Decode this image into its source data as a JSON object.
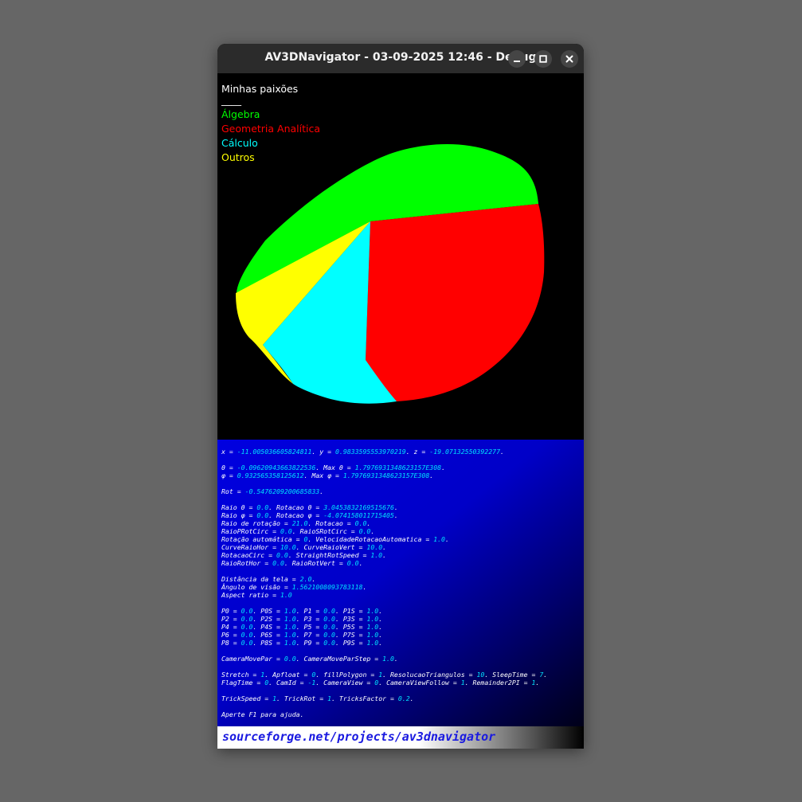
{
  "window": {
    "title": "AV3DNavigator - 03-09-2025 12:46 - Debug",
    "buttons": {
      "minimize_icon": "minimize-icon",
      "maximize_icon": "maximize-icon",
      "close_icon": "close-icon"
    }
  },
  "legend": {
    "title": "Minhas paixões",
    "separator": "____",
    "items": [
      {
        "label": "Álgebra",
        "color": "#00ff00"
      },
      {
        "label": "Geometria Analítica",
        "color": "#ff0000"
      },
      {
        "label": "Cálculo",
        "color": "#00ffff"
      },
      {
        "label": "Outros",
        "color": "#ffff00"
      }
    ]
  },
  "info_lines": [
    [
      [
        "x = ",
        0
      ],
      [
        "-11.005036605824811",
        1
      ],
      [
        ". y = ",
        0
      ],
      [
        "0.9833595553970219",
        1
      ],
      [
        ". z = ",
        0
      ],
      [
        "-19.07132550392277",
        1
      ],
      [
        ".",
        0
      ]
    ],
    [],
    [
      [
        "θ = ",
        0
      ],
      [
        "-0.09620943663822536",
        1
      ],
      [
        ". Max θ = ",
        0
      ],
      [
        "1.7976931348623157E308",
        1
      ],
      [
        ".",
        0
      ]
    ],
    [
      [
        "φ = ",
        0
      ],
      [
        "0.932565358125612",
        1
      ],
      [
        ". Max φ = ",
        0
      ],
      [
        "1.7976931348623157E308",
        1
      ],
      [
        ".",
        0
      ]
    ],
    [],
    [
      [
        "Rot = ",
        0
      ],
      [
        "-0.5476209200685833",
        1
      ],
      [
        ".",
        0
      ]
    ],
    [],
    [
      [
        "Raio θ = ",
        0
      ],
      [
        "0.0",
        1
      ],
      [
        ". Rotacao θ = ",
        0
      ],
      [
        "3.0453832169515676",
        1
      ],
      [
        ".",
        0
      ]
    ],
    [
      [
        "Raio φ = ",
        0
      ],
      [
        "0.0",
        1
      ],
      [
        ". Rotacao φ = ",
        0
      ],
      [
        "-4.074158011715405",
        1
      ],
      [
        ".",
        0
      ]
    ],
    [
      [
        "Raio de rotação = ",
        0
      ],
      [
        "21.0",
        1
      ],
      [
        ". Rotacao = ",
        0
      ],
      [
        "0.0",
        1
      ],
      [
        ".",
        0
      ]
    ],
    [
      [
        "RaioPRotCirc = ",
        0
      ],
      [
        "0.0",
        1
      ],
      [
        ". RaioSRotCirc = ",
        0
      ],
      [
        "0.0",
        1
      ],
      [
        ".",
        0
      ]
    ],
    [
      [
        "Rotação automática = ",
        0
      ],
      [
        "0",
        1
      ],
      [
        ". VelocidadeRotacaoAutomatica = ",
        0
      ],
      [
        "1.0",
        1
      ],
      [
        ".",
        0
      ]
    ],
    [
      [
        "CurveRaioHor = ",
        0
      ],
      [
        "10.0",
        1
      ],
      [
        ". CurveRaioVert = ",
        0
      ],
      [
        "10.0",
        1
      ],
      [
        ".",
        0
      ]
    ],
    [
      [
        "RotacaoCirc = ",
        0
      ],
      [
        "0.0",
        1
      ],
      [
        ". StraightRotSpeed = ",
        0
      ],
      [
        "1.0",
        1
      ],
      [
        ".",
        0
      ]
    ],
    [
      [
        "RaioRotHor = ",
        0
      ],
      [
        "0.0",
        1
      ],
      [
        ". RaioRotVert = ",
        0
      ],
      [
        "0.0",
        1
      ],
      [
        ".",
        0
      ]
    ],
    [],
    [
      [
        "Distância da tela = ",
        0
      ],
      [
        "2.0",
        1
      ],
      [
        ".",
        0
      ]
    ],
    [
      [
        "Ângulo de visão = ",
        0
      ],
      [
        "1.5621008093783118",
        1
      ],
      [
        ".",
        0
      ]
    ],
    [
      [
        "Aspect ratio = ",
        0
      ],
      [
        "1.0",
        1
      ]
    ],
    [],
    [
      [
        "P0 = ",
        0
      ],
      [
        "0.0",
        1
      ],
      [
        ". P0S = ",
        0
      ],
      [
        "1.0",
        1
      ],
      [
        ". P1 = ",
        0
      ],
      [
        "0.0",
        1
      ],
      [
        ". P1S = ",
        0
      ],
      [
        "1.0",
        1
      ],
      [
        ".",
        0
      ]
    ],
    [
      [
        "P2 = ",
        0
      ],
      [
        "0.0",
        1
      ],
      [
        ". P2S = ",
        0
      ],
      [
        "1.0",
        1
      ],
      [
        ". P3 = ",
        0
      ],
      [
        "0.0",
        1
      ],
      [
        ". P3S = ",
        0
      ],
      [
        "1.0",
        1
      ],
      [
        ".",
        0
      ]
    ],
    [
      [
        "P4 = ",
        0
      ],
      [
        "0.0",
        1
      ],
      [
        ". P4S = ",
        0
      ],
      [
        "1.0",
        1
      ],
      [
        ". P5 = ",
        0
      ],
      [
        "0.0",
        1
      ],
      [
        ". P5S = ",
        0
      ],
      [
        "1.0",
        1
      ],
      [
        ".",
        0
      ]
    ],
    [
      [
        "P6 = ",
        0
      ],
      [
        "0.0",
        1
      ],
      [
        ". P6S = ",
        0
      ],
      [
        "1.0",
        1
      ],
      [
        ". P7 = ",
        0
      ],
      [
        "0.0",
        1
      ],
      [
        ". P7S = ",
        0
      ],
      [
        "1.0",
        1
      ],
      [
        ".",
        0
      ]
    ],
    [
      [
        "P8 = ",
        0
      ],
      [
        "0.0",
        1
      ],
      [
        ". P8S = ",
        0
      ],
      [
        "1.0",
        1
      ],
      [
        ". P9 = ",
        0
      ],
      [
        "0.0",
        1
      ],
      [
        ". P9S = ",
        0
      ],
      [
        "1.0",
        1
      ],
      [
        ".",
        0
      ]
    ],
    [],
    [
      [
        "CameraMovePar = ",
        0
      ],
      [
        "0.0",
        1
      ],
      [
        ". CameraMoveParStep = ",
        0
      ],
      [
        "1.0",
        1
      ],
      [
        ".",
        0
      ]
    ],
    [],
    [
      [
        "Stretch = ",
        0
      ],
      [
        "1",
        1
      ],
      [
        ". Apfloat = ",
        0
      ],
      [
        "0",
        1
      ],
      [
        ". fillPolygon = ",
        0
      ],
      [
        "1",
        1
      ],
      [
        ". ResolucaoTriangulos = ",
        0
      ],
      [
        "10",
        1
      ],
      [
        ". SleepTime = ",
        0
      ],
      [
        "7",
        1
      ],
      [
        ".",
        0
      ]
    ],
    [
      [
        "FlagTime = ",
        0
      ],
      [
        "0",
        1
      ],
      [
        ". CamId = ",
        0
      ],
      [
        "-1",
        1
      ],
      [
        ". CameraView = ",
        0
      ],
      [
        "0",
        1
      ],
      [
        ". CameraViewFollow = ",
        0
      ],
      [
        "1",
        1
      ],
      [
        ". Remainder2PI = ",
        0
      ],
      [
        "1",
        1
      ],
      [
        ".",
        0
      ]
    ],
    [],
    [
      [
        "TrickSpeed = ",
        0
      ],
      [
        "1",
        1
      ],
      [
        ". TrickRot = ",
        0
      ],
      [
        "1",
        1
      ],
      [
        ". TricksFactor = ",
        0
      ],
      [
        "0.2",
        1
      ],
      [
        ".",
        0
      ]
    ],
    [],
    [
      [
        "Aperte F1 para ajuda.",
        0
      ]
    ]
  ],
  "footer": {
    "link_text": "sourceforge.net/projects/av3dnavigator"
  }
}
